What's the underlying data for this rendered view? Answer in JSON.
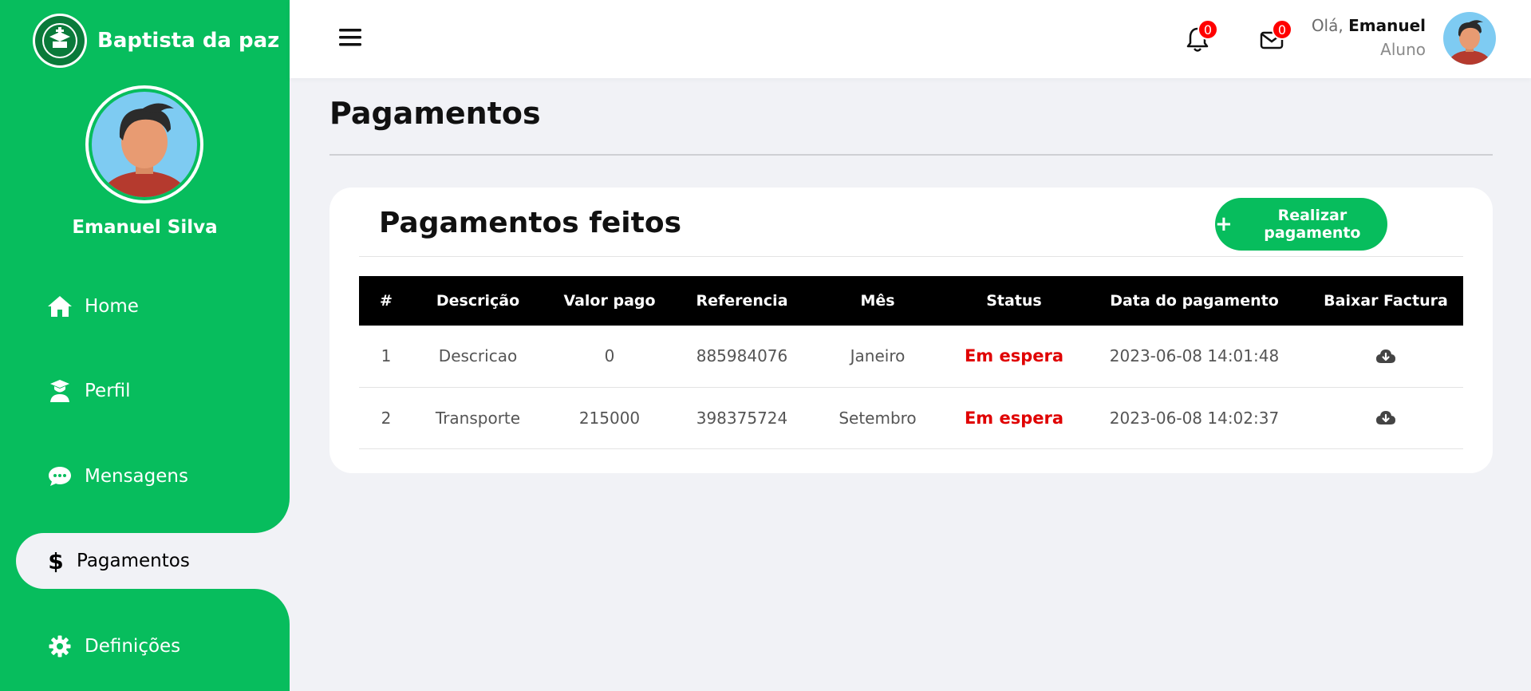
{
  "brand": {
    "name": "Baptista da paz"
  },
  "sidebar": {
    "profile_name": "Emanuel Silva",
    "items": [
      {
        "label": "Home",
        "icon": "home-icon"
      },
      {
        "label": "Perfil",
        "icon": "student-icon"
      },
      {
        "label": "Mensagens",
        "icon": "chat-icon"
      },
      {
        "label": "Pagamentos",
        "icon": "dollar-icon",
        "active": true
      },
      {
        "label": "Definições",
        "icon": "gear-icon"
      }
    ]
  },
  "topbar": {
    "notifications_count": "0",
    "messages_count": "0",
    "greeting_prefix": "Olá,",
    "user_first_name": "Emanuel",
    "user_role": "Aluno"
  },
  "page": {
    "title": "Pagamentos",
    "card_title": "Pagamentos feitos",
    "pay_button": "Realizar pagamento"
  },
  "table": {
    "headers": [
      "#",
      "Descrição",
      "Valor pago",
      "Referencia",
      "Mês",
      "Status",
      "Data do pagamento",
      "Baixar Factura"
    ],
    "rows": [
      {
        "num": "1",
        "descricao": "Descricao",
        "valor": "0",
        "referencia": "885984076",
        "mes": "Janeiro",
        "status": "Em espera",
        "data": "2023-06-08 14:01:48"
      },
      {
        "num": "2",
        "descricao": "Transporte",
        "valor": "215000",
        "referencia": "398375724",
        "mes": "Setembro",
        "status": "Em espera",
        "data": "2023-06-08 14:02:37"
      }
    ]
  },
  "colors": {
    "brand_green": "#07bd5d",
    "status_red": "#e00000",
    "background": "#f1f2f6"
  }
}
